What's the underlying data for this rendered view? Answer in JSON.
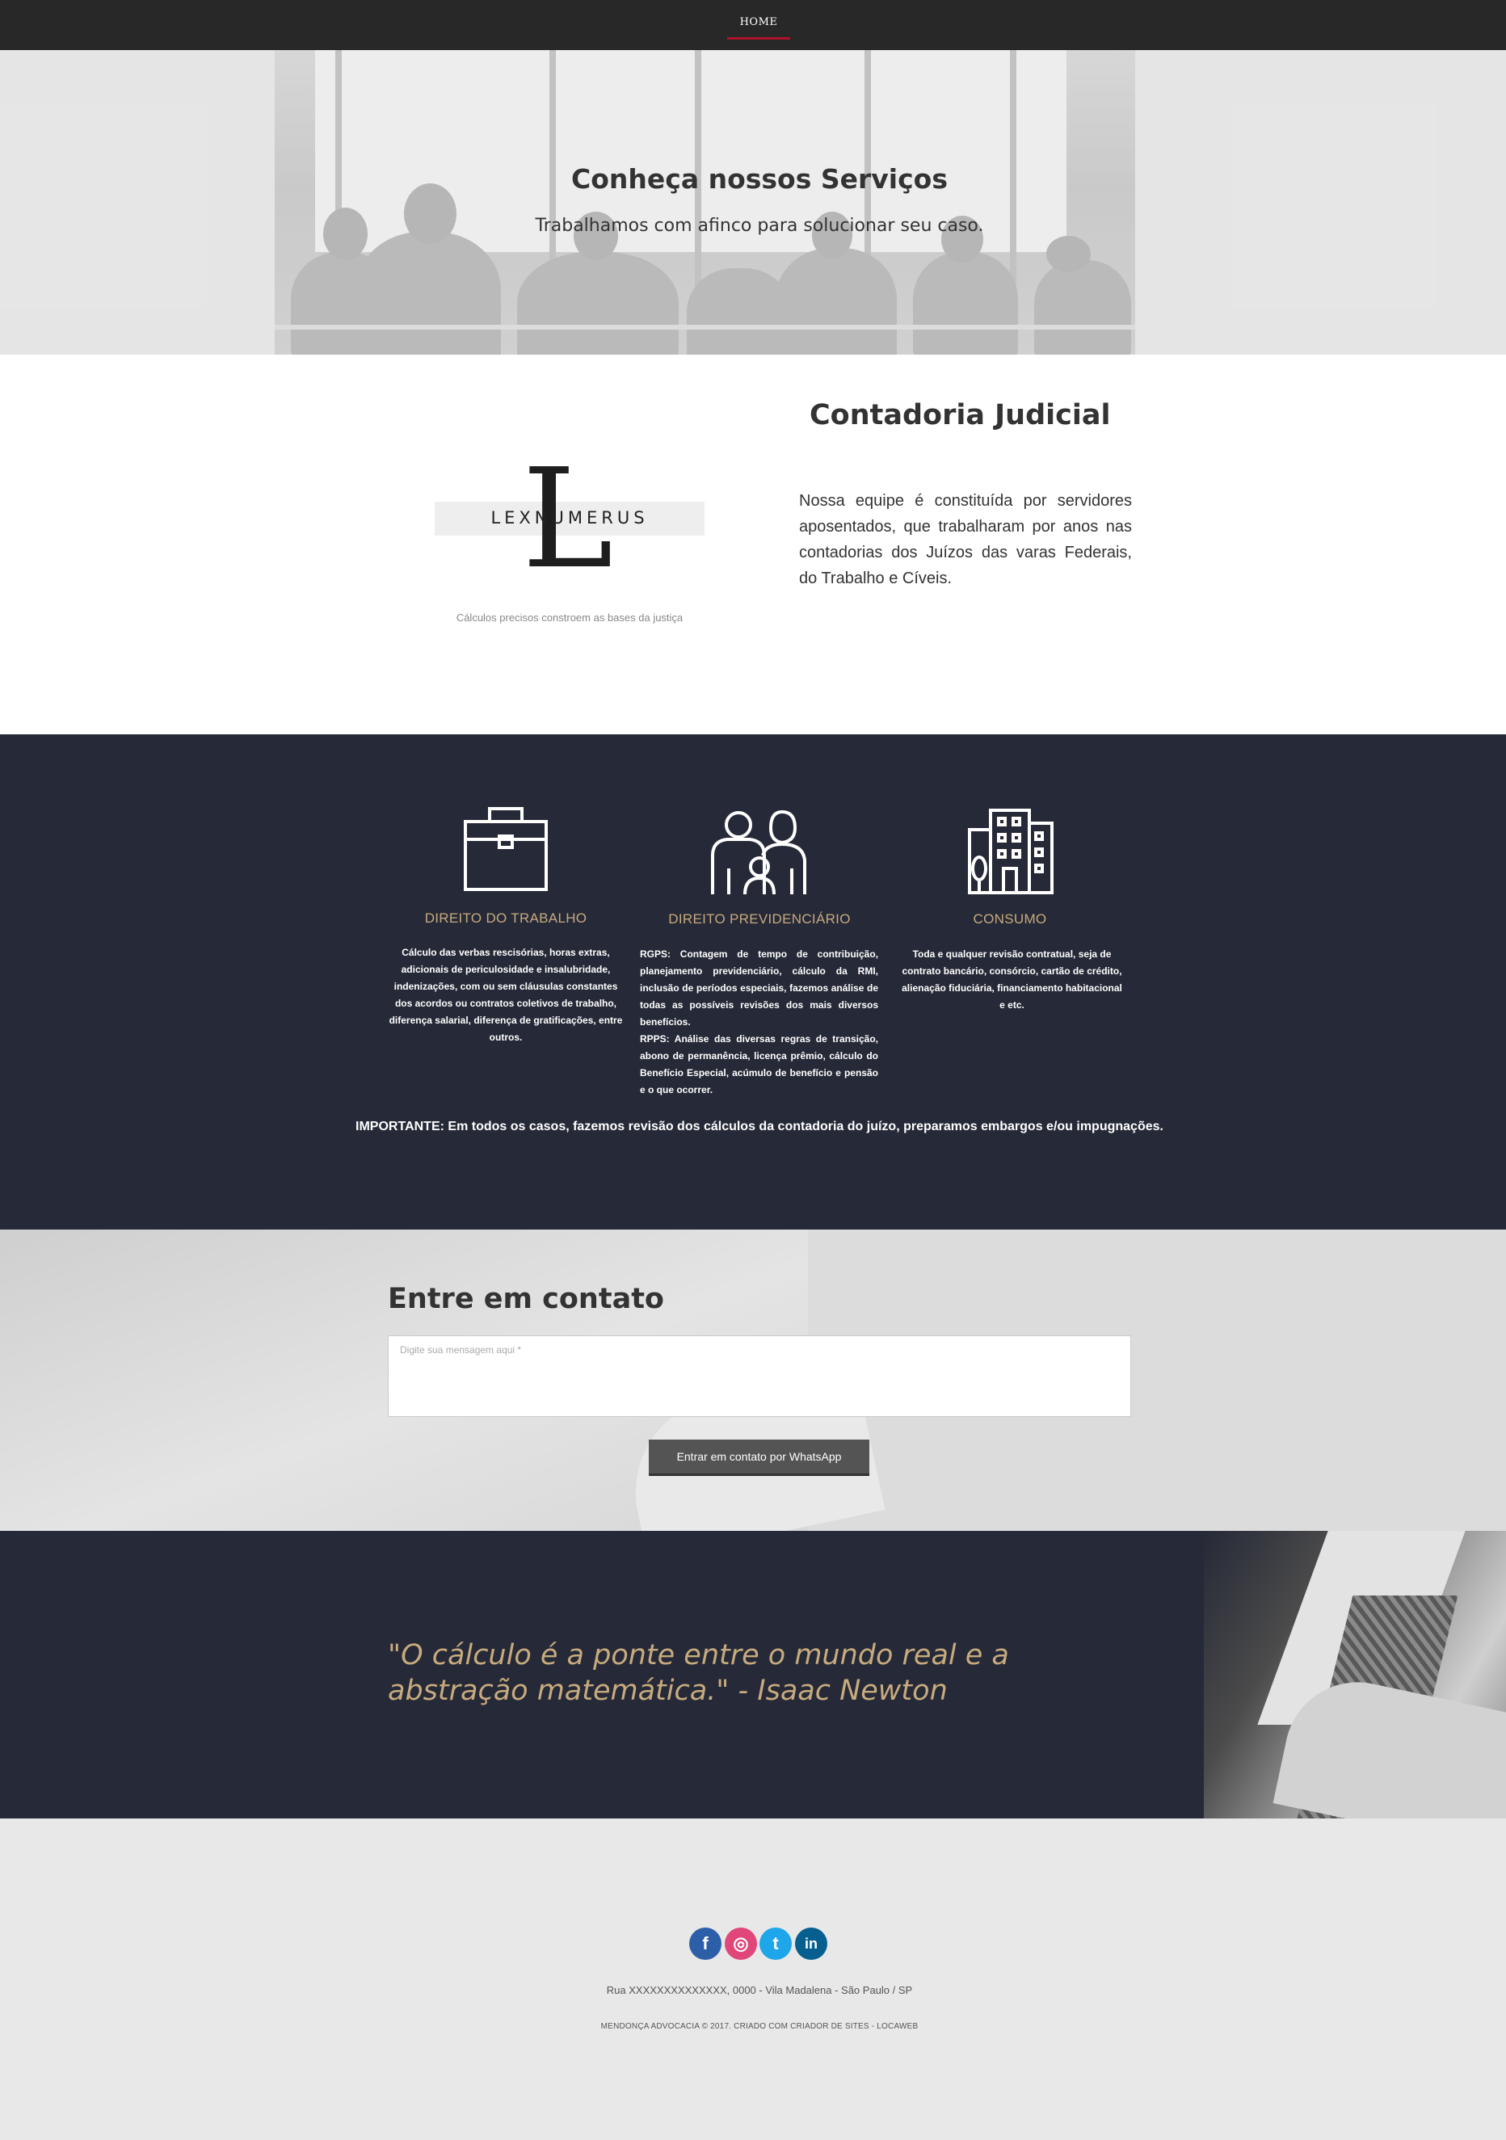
{
  "nav": {
    "home_label": "HOME"
  },
  "hero": {
    "title": "Conheça nossos Serviços",
    "subtitle": "Trabalhamos com afinco para solucionar seu caso."
  },
  "contadoria": {
    "logo_word": "LEXNUMERUS",
    "logo_letter": "L",
    "logo_tagline": "Cálculos precisos constroem as bases da justiça",
    "title": "Contadoria Judicial",
    "text": "Nossa equipe é constituída por servidores aposentados, que trabalharam por anos nas contadorias dos Juízos das varas Federais, do Trabalho e Cíveis."
  },
  "services": {
    "items": [
      {
        "icon": "briefcase-icon",
        "title": "DIREITO DO TRABALHO",
        "text": "Cálculo das verbas rescisórias, horas extras, adicionais de periculosidade e insalubridade, indenizações, com ou sem cláusulas constantes dos acordos ou contratos coletivos de trabalho, diferença salarial, diferença de gratificações, entre outros."
      },
      {
        "icon": "family-icon",
        "title": "DIREITO PREVIDENCIÁRIO",
        "rgps_label": "RGPS:",
        "rgps_text": " Contagem de tempo de contribuição, planejamento previdenciário, cálculo da RMI, inclusão de períodos especiais, fazemos análise de todas as possíveis revisões dos mais diversos benefícios.",
        "rpps_label": "RPPS:",
        "rpps_text": " Análise das diversas regras de transição, abono de permanência, licença prêmio, cálculo do Benefício Especial, acúmulo de benefício e pensão e o que ocorrer."
      },
      {
        "icon": "buildings-icon",
        "title": "CONSUMO",
        "text": "Toda e qualquer revisão contratual, seja de contrato bancário, consórcio, cartão de crédito, alienação fiduciária, financiamento habitacional e etc."
      }
    ],
    "important": "IMPORTANTE: Em todos os casos, fazemos revisão dos cálculos da contadoria do juízo, preparamos embargos e/ou impugnações."
  },
  "contact": {
    "title": "Entre em contato",
    "placeholder": "Digite sua mensagem aqui *",
    "button_label": "Entrar em contato por WhatsApp"
  },
  "quote": {
    "text": "\"O cálculo é a ponte entre o mundo real e a abstração matemática.\" - Isaac Newton"
  },
  "footer": {
    "social": [
      {
        "icon": "facebook-icon",
        "glyph": "f",
        "color": "#2d5fa8"
      },
      {
        "icon": "instagram-icon",
        "glyph": "◎",
        "color": "#e0467a"
      },
      {
        "icon": "twitter-icon",
        "glyph": "t",
        "color": "#1da6e9"
      },
      {
        "icon": "linkedin-icon",
        "glyph": "in",
        "color": "#075f90"
      }
    ],
    "address": "Rua XXXXXXXXXXXXXX, 0000  - Vila Madalena - São Paulo / SP",
    "copyright": "MENDONÇA ADVOCACIA © 2017. CRIADO COM CRIADOR DE SITES - LOCAWEB"
  },
  "colors": {
    "dark_bg": "#262937",
    "gold": "#c7ab7e",
    "nav_accent": "#b0122a",
    "button": "#545454"
  }
}
